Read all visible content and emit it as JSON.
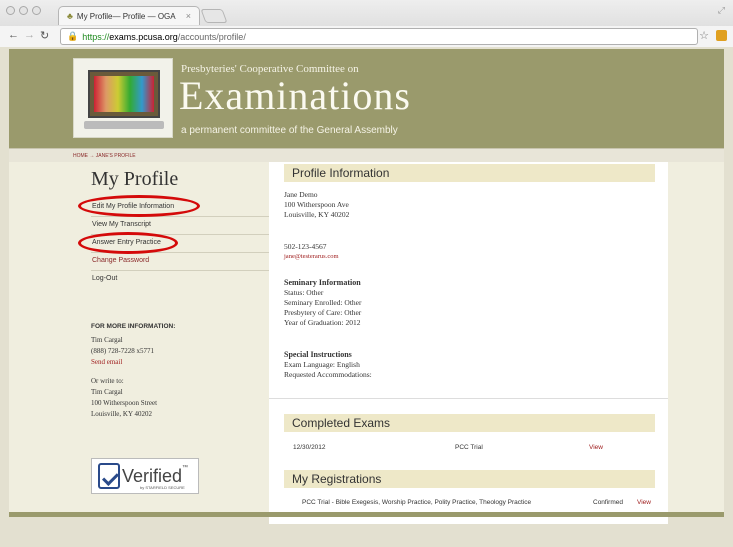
{
  "browser": {
    "tab_title": "My Profile— Profile — OGA",
    "tab_close": "×",
    "url_scheme": "https://",
    "url_host": "exams.pcusa.org",
    "url_path": "/accounts/profile/"
  },
  "site": {
    "header_line1": "Presbyteries' Cooperative Committee on",
    "header_title": "Examinations",
    "header_sub": "a permanent committee of the General Assembly"
  },
  "breadcrumb": {
    "home": "HOME",
    "sep": "→",
    "current": "JANE'S PROFILE"
  },
  "sidebar": {
    "title": "My Profile",
    "menu": [
      {
        "label": "Edit My Profile Information"
      },
      {
        "label": "View My Transcript"
      },
      {
        "label": "Answer Entry Practice"
      },
      {
        "label": "Change Password"
      },
      {
        "label": "Log-Out"
      }
    ],
    "info_heading": "FOR MORE INFORMATION:",
    "contact_name": "Tim Cargal",
    "contact_phone": "(888) 728-7228 x5771",
    "send_email": "Send email",
    "write_to": "Or write to:",
    "addr_name": "Tim Cargal",
    "addr_street": "100 Witherspoon Street",
    "addr_city": "Louisville, KY 40202",
    "verified_label": "Verified",
    "verified_tm": "™",
    "verified_small": "by STARFIELD SECURE"
  },
  "profile": {
    "heading": "Profile Information",
    "name": "Jane Demo",
    "street": "100 Witherspoon Ave",
    "city": "Louisville, KY 40202",
    "phone": "502-123-4567",
    "email": "jane@testerarus.com",
    "seminary_heading": "Seminary Information",
    "status": "Status: Other",
    "seminary_enrolled": "Seminary Enrolled: Other",
    "presbytery": "Presbytery of Care: Other",
    "grad_year": "Year of Graduation: 2012",
    "special_heading": "Special Instructions",
    "exam_language": "Exam Language: English",
    "accommodations": "Requested Accommodations:"
  },
  "completed_exams": {
    "heading": "Completed Exams",
    "rows": [
      {
        "date": "12/30/2012",
        "name": "PCC Trial",
        "action": "View"
      }
    ]
  },
  "registrations": {
    "heading": "My Registrations",
    "rows": [
      {
        "name": "PCC Trial - Bible Exegesis, Worship Practice, Polity Practice, Theology Practice",
        "status": "Confirmed",
        "action": "View"
      }
    ]
  },
  "colors": {
    "accent_olive": "#9a9a6c",
    "link_red": "#a02020",
    "highlight_oval": "#d40a0a"
  }
}
